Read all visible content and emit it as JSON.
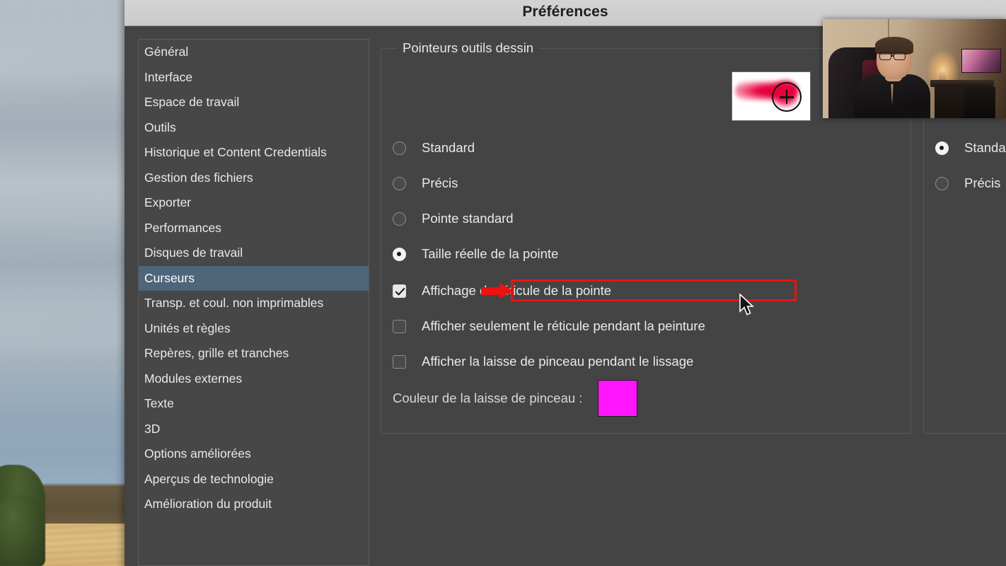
{
  "dialog": {
    "title": "Préférences"
  },
  "sidebar": {
    "items": [
      {
        "label": "Général",
        "selected": false
      },
      {
        "label": "Interface",
        "selected": false
      },
      {
        "label": "Espace de travail",
        "selected": false
      },
      {
        "label": "Outils",
        "selected": false
      },
      {
        "label": "Historique et Content Credentials",
        "selected": false
      },
      {
        "label": "Gestion des fichiers",
        "selected": false
      },
      {
        "label": "Exporter",
        "selected": false
      },
      {
        "label": "Performances",
        "selected": false
      },
      {
        "label": "Disques de travail",
        "selected": false
      },
      {
        "label": "Curseurs",
        "selected": true
      },
      {
        "label": "Transp. et coul. non imprimables",
        "selected": false
      },
      {
        "label": "Unités et règles",
        "selected": false
      },
      {
        "label": "Repères, grille et tranches",
        "selected": false
      },
      {
        "label": "Modules externes",
        "selected": false
      },
      {
        "label": "Texte",
        "selected": false
      },
      {
        "label": "3D",
        "selected": false
      },
      {
        "label": "Options améliorées",
        "selected": false
      },
      {
        "label": "Aperçus de technologie",
        "selected": false
      },
      {
        "label": "Amélioration du produit",
        "selected": false
      }
    ]
  },
  "paint_group": {
    "legend": "Pointeurs outils dessin",
    "preview_name": "brush-tip-preview",
    "radios": [
      {
        "label": "Standard",
        "checked": false
      },
      {
        "label": "Précis",
        "checked": false
      },
      {
        "label": "Pointe standard",
        "checked": false
      },
      {
        "label": "Taille réelle de la pointe",
        "checked": true
      }
    ],
    "checkboxes": [
      {
        "label": "Affichage du réticule de la pointe",
        "checked": true
      },
      {
        "label": "Afficher seulement le réticule pendant la peinture",
        "checked": false
      },
      {
        "label": "Afficher la laisse de pinceau pendant le lissage",
        "checked": false
      }
    ],
    "swatch": {
      "label": "Couleur de la laisse de pinceau :",
      "color": "#ff16ff"
    }
  },
  "other_group": {
    "radios": [
      {
        "label": "Standard",
        "checked": true
      },
      {
        "label": "Précis",
        "checked": false
      }
    ]
  },
  "annotations": {
    "highlight_color": "#ee1111",
    "arrow_name": "red-arrow-annotation",
    "highlight_name": "red-highlight-box",
    "cursor_name": "mouse-pointer"
  },
  "colors": {
    "dialog_bg": "#444444",
    "sidebar_bg": "#474747",
    "selection": "#4e657a",
    "titlebar": "#d4d4d4",
    "text": "#e9e9e9"
  }
}
